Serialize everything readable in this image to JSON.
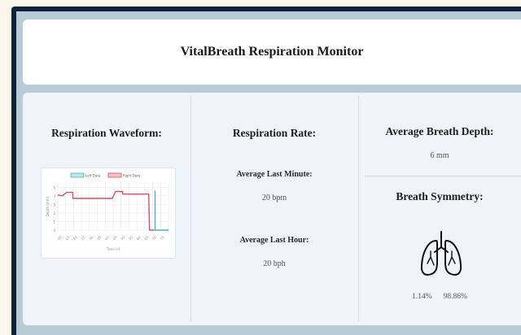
{
  "header": {
    "title": "VitalBreath Respiration Monitor"
  },
  "waveform": {
    "title": "Respiration Waveform:",
    "chart_data": {
      "type": "line",
      "x": [
        0,
        1,
        2,
        3,
        4,
        5,
        6,
        7,
        8,
        9,
        10,
        11,
        12,
        13,
        14
      ],
      "xlim": [
        0,
        14
      ],
      "ylim": [
        0,
        5.5
      ],
      "ylabel": "Depth (mm)",
      "xlabel": "Time (s)",
      "x_tick_labels": [
        "10",
        "15",
        "20",
        "25",
        "30",
        "35",
        "40",
        "45",
        "50",
        "55",
        "60",
        "65",
        "70",
        "75"
      ],
      "y_tick_labels": [
        "0",
        "1",
        "2",
        "3",
        "4",
        "5"
      ],
      "legend_placement": "top",
      "grid": true,
      "series": [
        {
          "name": "Left Data",
          "color": "#4fb3b0",
          "points": [
            [
              12.2,
              4.5
            ],
            [
              12.3,
              4.5
            ],
            [
              12.3,
              0.0
            ],
            [
              14,
              0.0
            ]
          ]
        },
        {
          "name": "Right Data",
          "color": "#d94f6a",
          "points": [
            [
              0,
              4.1
            ],
            [
              0.6,
              4.0
            ],
            [
              1.1,
              4.4
            ],
            [
              1.9,
              4.4
            ],
            [
              1.9,
              3.7
            ],
            [
              6.9,
              3.7
            ],
            [
              7.3,
              4.5
            ],
            [
              8.2,
              4.5
            ],
            [
              8.2,
              4.2
            ],
            [
              11.5,
              4.2
            ],
            [
              11.6,
              0.0
            ],
            [
              12.2,
              0.0
            ]
          ]
        }
      ]
    }
  },
  "rate": {
    "title": "Respiration Rate:",
    "last_minute_label": "Average Last Minute:",
    "last_minute_value": "20 bpm",
    "last_hour_label": "Average Last Hour:",
    "last_hour_value": "20 bph"
  },
  "depth": {
    "title": "Average Breath Depth:",
    "value": "6 mm"
  },
  "symmetry": {
    "title": "Breath Symmetry:",
    "left_percent": "1.14%",
    "right_percent": "98.86%",
    "icon": "lungs-icon"
  }
}
